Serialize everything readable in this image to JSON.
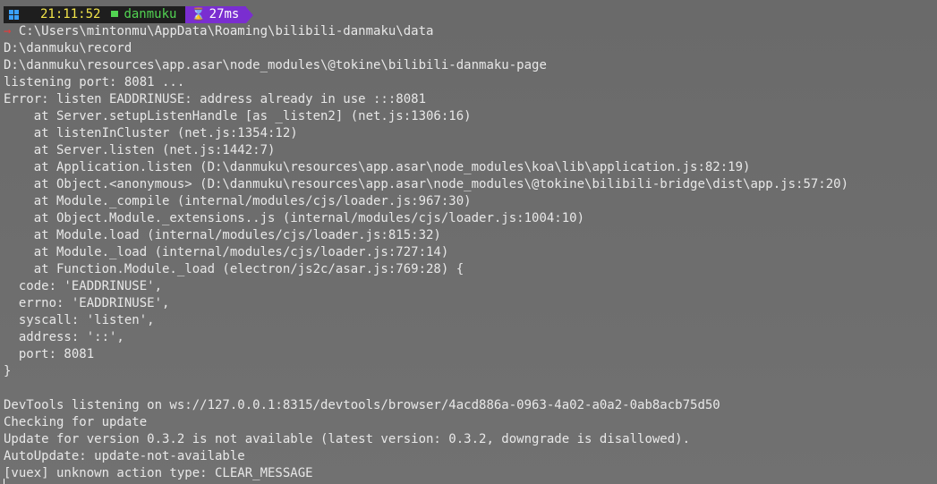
{
  "prompt": {
    "os_icon": "windows-icon",
    "time": "21:11:52",
    "dir_icon": "folder-icon",
    "dir": "danmuku",
    "duration_icon": "hourglass-icon",
    "duration": "27ms"
  },
  "colors": {
    "background": "#6e6e6e",
    "text": "#e8e8e8",
    "time": "#f2e44a",
    "dir": "#52d452",
    "duration_bg": "#7a2ed0",
    "prompt_arrow": "#e83a3a"
  },
  "first_line": {
    "arrow": "→",
    "text": " C:\\Users\\mintonmu\\AppData\\Roaming\\bilibili-danmaku\\data"
  },
  "output_lines": [
    "D:\\danmuku\\record",
    "D:\\danmuku\\resources\\app.asar\\node_modules\\@tokine\\bilibili-danmaku-page",
    "listening port: 8081 ...",
    "Error: listen EADDRINUSE: address already in use :::8081",
    "    at Server.setupListenHandle [as _listen2] (net.js:1306:16)",
    "    at listenInCluster (net.js:1354:12)",
    "    at Server.listen (net.js:1442:7)",
    "    at Application.listen (D:\\danmuku\\resources\\app.asar\\node_modules\\koa\\lib\\application.js:82:19)",
    "    at Object.<anonymous> (D:\\danmuku\\resources\\app.asar\\node_modules\\@tokine\\bilibili-bridge\\dist\\app.js:57:20)",
    "    at Module._compile (internal/modules/cjs/loader.js:967:30)",
    "    at Object.Module._extensions..js (internal/modules/cjs/loader.js:1004:10)",
    "    at Module.load (internal/modules/cjs/loader.js:815:32)",
    "    at Module._load (internal/modules/cjs/loader.js:727:14)",
    "    at Function.Module._load (electron/js2c/asar.js:769:28) {",
    "  code: 'EADDRINUSE',",
    "  errno: 'EADDRINUSE',",
    "  syscall: 'listen',",
    "  address: '::',",
    "  port: 8081",
    "}",
    "",
    "DevTools listening on ws://127.0.0.1:8315/devtools/browser/4acd886a-0963-4a02-a0a2-0ab8acb75d50",
    "Checking for update",
    "Update for version 0.3.2 is not available (latest version: 0.3.2, downgrade is disallowed).",
    "AutoUpdate: update-not-available",
    "[vuex] unknown action type: CLEAR_MESSAGE"
  ]
}
